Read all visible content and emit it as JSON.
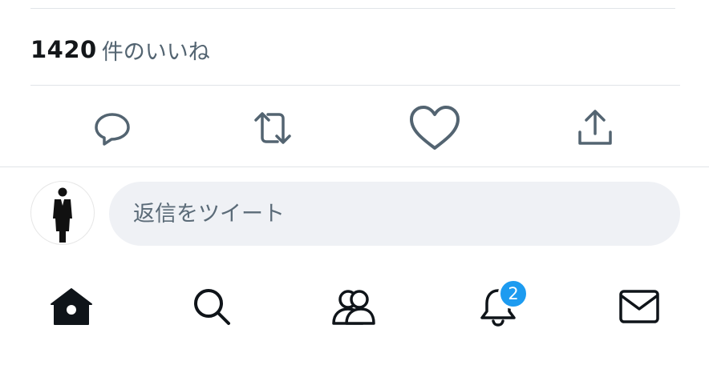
{
  "tweet": {
    "likes_count": "1420",
    "likes_label": "件のいいね"
  },
  "actions": [
    {
      "name": "reply",
      "icon": "speech-bubble-icon"
    },
    {
      "name": "retweet",
      "icon": "retweet-icon"
    },
    {
      "name": "like",
      "icon": "heart-icon"
    },
    {
      "name": "share",
      "icon": "share-icon"
    }
  ],
  "reply": {
    "placeholder": "返信をツイート"
  },
  "tabbar": {
    "items": [
      {
        "name": "home",
        "icon": "home-icon"
      },
      {
        "name": "search",
        "icon": "search-icon"
      },
      {
        "name": "communities",
        "icon": "people-icon"
      },
      {
        "name": "notifications",
        "icon": "bell-icon",
        "badge": "2"
      },
      {
        "name": "messages",
        "icon": "envelope-icon"
      }
    ]
  },
  "colors": {
    "icon_gray": "#536471",
    "icon_dark": "#0f1419",
    "badge_blue": "#1d9bf0",
    "input_bg": "#eff1f5",
    "divider": "#e1e4e8"
  }
}
